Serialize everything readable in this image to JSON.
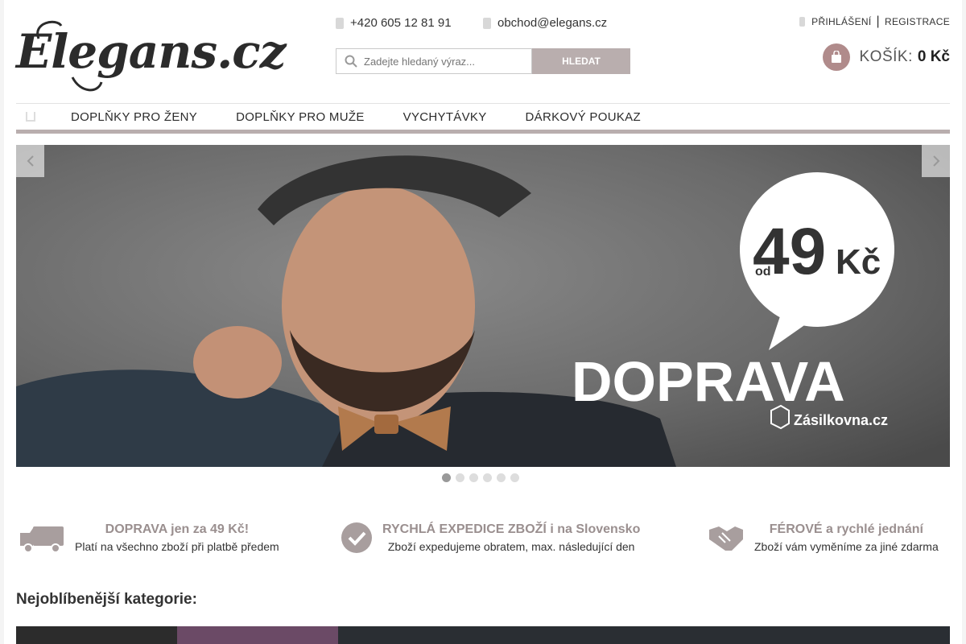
{
  "logo": {
    "text": "Elegans.cz"
  },
  "contact": {
    "phone": "+420 605 12 81 91",
    "email": "obchod@elegans.cz"
  },
  "search": {
    "placeholder": "Zadejte hledaný výraz...",
    "button_label": "HLEDAT"
  },
  "account": {
    "login": "PŘIHLÁŠENÍ",
    "separator": "|",
    "register": "REGISTRACE"
  },
  "cart": {
    "label": "KOŠÍK:",
    "total": "0 Kč"
  },
  "nav": {
    "items": [
      {
        "label": "DOPLŇKY PRO ŽENY"
      },
      {
        "label": "DOPLŇKY PRO MUŽE"
      },
      {
        "label": "VYCHYTÁVKY"
      },
      {
        "label": "DÁRKOVÝ POUKAZ"
      }
    ]
  },
  "banner": {
    "price_prefix": "od",
    "price_value": "49",
    "price_currency": "Kč",
    "headline": "DOPRAVA",
    "partner": "Zásilkovna.cz",
    "slide_count": 6,
    "active_slide": 1
  },
  "features": [
    {
      "icon": "truck-icon",
      "title": "DOPRAVA jen za 49 Kč!",
      "subtitle": "Platí na všechno zboží při platbě předem"
    },
    {
      "icon": "checkmark-icon",
      "title": "RYCHLÁ EXPEDICE ZBOŽÍ i na Slovensko",
      "subtitle": "Zboží expedujeme obratem, max. následující den"
    },
    {
      "icon": "handshake-icon",
      "title": "FÉROVÉ a rychlé jednání",
      "subtitle": "Zboží vám vyměníme za jiné zdarma"
    }
  ],
  "categories": {
    "heading": "Nejoblíbenější kategorie:"
  },
  "colors": {
    "accent": "#b9aeae",
    "cart": "#b08b8b",
    "feature_title": "#9a8f8f"
  }
}
